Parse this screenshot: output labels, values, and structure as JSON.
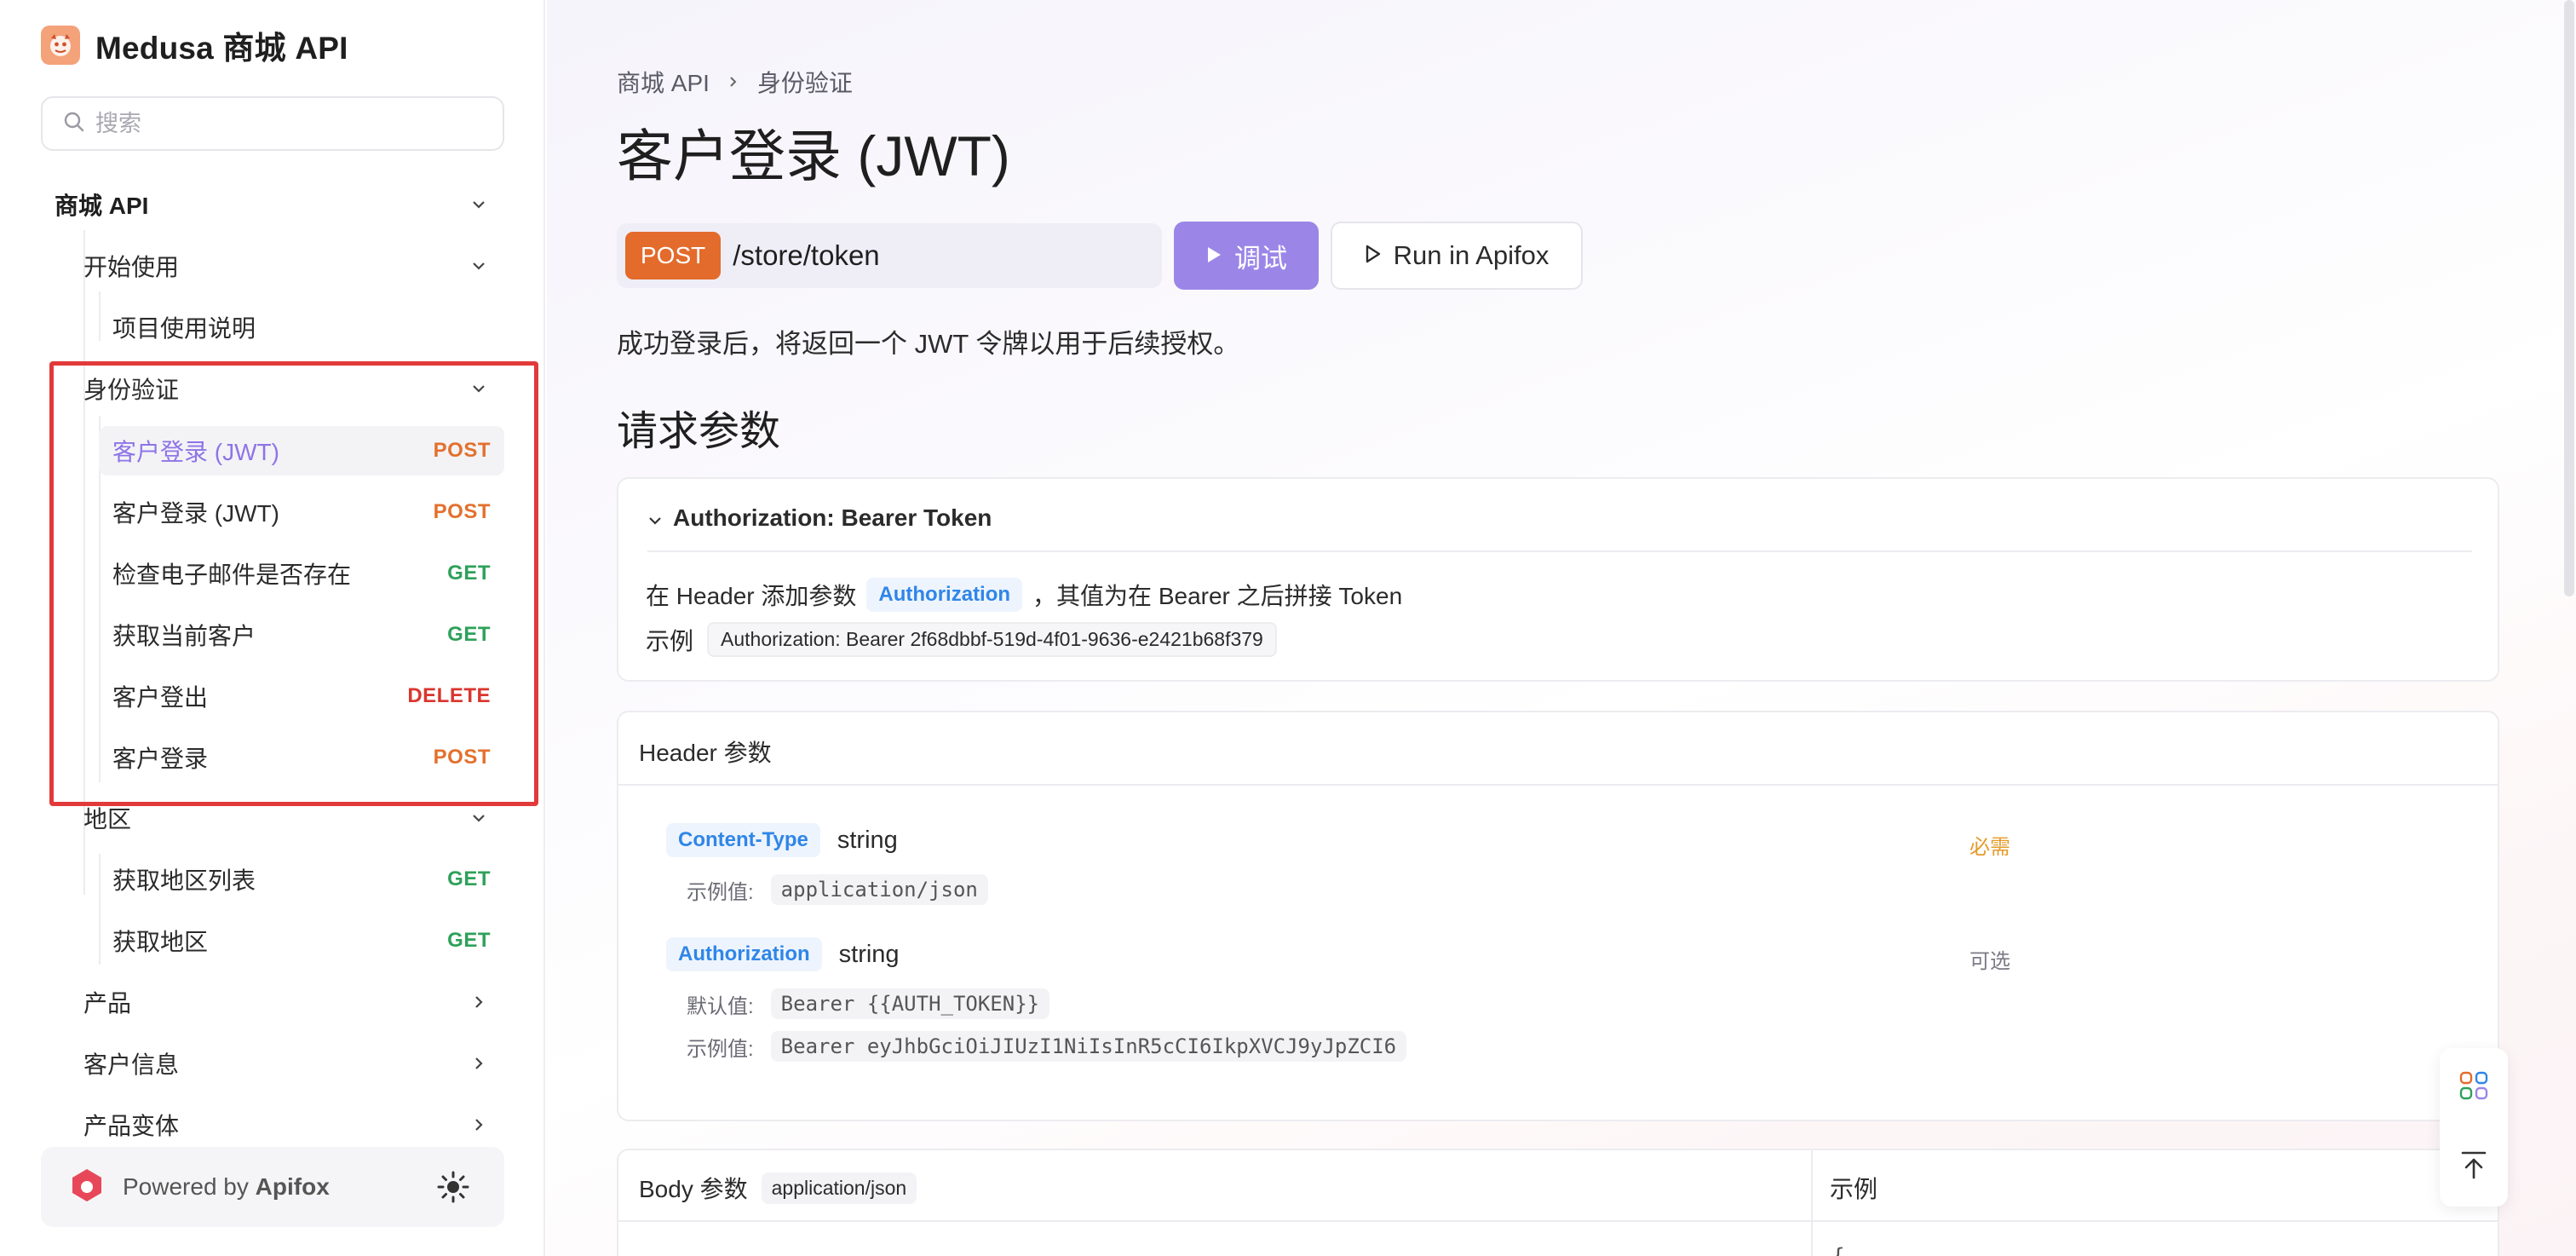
{
  "app": {
    "title": "Medusa 商城 API"
  },
  "search": {
    "placeholder": "搜索"
  },
  "sidebar": {
    "groups": [
      {
        "label": "商城 API"
      },
      {
        "label": "开始使用"
      },
      {
        "label": "项目使用说明"
      },
      {
        "label": "身份验证"
      },
      {
        "label": "地区"
      },
      {
        "label": "产品"
      },
      {
        "label": "客户信息"
      },
      {
        "label": "产品变体"
      }
    ],
    "auth_items": [
      {
        "label": "客户登录 (JWT)",
        "method": "POST"
      },
      {
        "label": "客户登录 (JWT)",
        "method": "POST"
      },
      {
        "label": "检查电子邮件是否存在",
        "method": "GET"
      },
      {
        "label": "获取当前客户",
        "method": "GET"
      },
      {
        "label": "客户登出",
        "method": "DELETE"
      },
      {
        "label": "客户登录",
        "method": "POST"
      }
    ],
    "region_items": [
      {
        "label": "获取地区列表",
        "method": "GET"
      },
      {
        "label": "获取地区",
        "method": "GET"
      }
    ],
    "powered_prefix": "Powered by",
    "powered_brand": "Apifox"
  },
  "breadcrumb": {
    "root": "商城 API",
    "current": "身份验证"
  },
  "page": {
    "title": "客户登录 (JWT)",
    "method": "POST",
    "path": "/store/token",
    "try_label": "调试",
    "run_label": "Run in Apifox",
    "description": "成功登录后，将返回一个 JWT 令牌以用于后续授权。",
    "section_request": "请求参数"
  },
  "auth": {
    "heading": "Authorization: Bearer Token",
    "line_prefix": "在 Header 添加参数",
    "param": "Authorization",
    "line_suffix": "，其值为在 Bearer 之后拼接 Token",
    "example_label": "示例",
    "example_value": "Authorization: Bearer 2f68dbbf-519d-4f01-9636-e2421b68f379"
  },
  "header_params": {
    "title": "Header 参数",
    "params": [
      {
        "name": "Content-Type",
        "type": "string",
        "flag": "必需",
        "example_label": "示例值:",
        "example": "application/json"
      },
      {
        "name": "Authorization",
        "type": "string",
        "flag": "可选",
        "default_label": "默认值:",
        "default": "Bearer {{AUTH_TOKEN}}",
        "example_label": "示例值:",
        "example": "Bearer eyJhbGciOiJIUzI1NiIsInR5cCI6IkpXVCJ9yJpZCI6"
      }
    ]
  },
  "body_params": {
    "title": "Body 参数",
    "content_type": "application/json",
    "example_title": "示例",
    "example_start": "{"
  },
  "colors": {
    "accent": "#9b86e8",
    "post": "#e36b2c",
    "get": "#2ea15a",
    "delete": "#d9362e",
    "highlight": "#e2393a"
  }
}
